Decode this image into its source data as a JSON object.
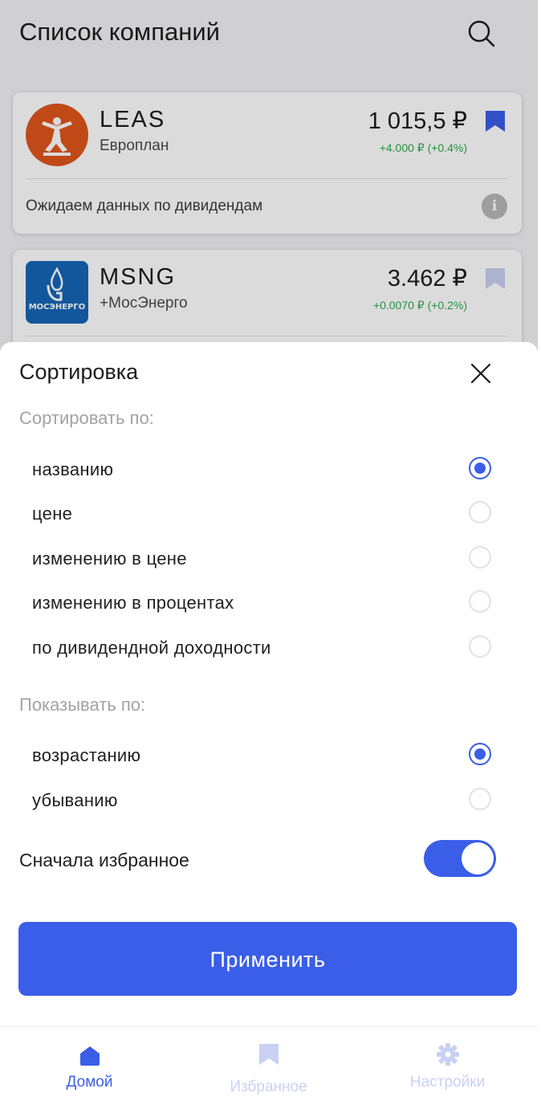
{
  "header": {
    "title": "Список компаний",
    "search_icon": "search-icon"
  },
  "companies": [
    {
      "ticker": "LEAS",
      "name": "Европлан",
      "price": "1 015,5 ₽",
      "change": "+4.000 ₽  (+0.4%)",
      "bookmarked": true,
      "dividend_text": "Ожидаем данных по дивидендам",
      "logo_color": "#e0561c"
    },
    {
      "ticker": "MSNG",
      "name": "+МосЭнерго",
      "price": "3.462 ₽",
      "change": "+0.0070 ₽  (+0.2%)",
      "bookmarked": false,
      "logo_text": "МОСЭНЕРГО",
      "logo_color": "#1566b6"
    }
  ],
  "sort_sheet": {
    "title": "Сортировка",
    "sort_by_label": "Сортировать по:",
    "sort_options": [
      {
        "label": "названию",
        "checked": true
      },
      {
        "label": "цене",
        "checked": false
      },
      {
        "label": "изменению в цене",
        "checked": false
      },
      {
        "label": "изменению в процентах",
        "checked": false
      },
      {
        "label": "по дивидендной доходности",
        "checked": false
      }
    ],
    "order_label": "Показывать по:",
    "order_options": [
      {
        "label": "возрастанию",
        "checked": true
      },
      {
        "label": "убыванию",
        "checked": false
      }
    ],
    "favorites_first_label": "Сначала избранное",
    "favorites_first_on": true,
    "apply_label": "Применить"
  },
  "nav": [
    {
      "label": "Домой",
      "icon": "home-icon",
      "active": true
    },
    {
      "label": "Избранное",
      "icon": "bookmark-icon",
      "active": false
    },
    {
      "label": "Настройки",
      "icon": "gear-icon",
      "active": false
    }
  ],
  "colors": {
    "accent": "#3a5ee8",
    "positive": "#2fa84f",
    "muted": "#a2a2a8",
    "nav_inactive": "#c9d1f3"
  }
}
